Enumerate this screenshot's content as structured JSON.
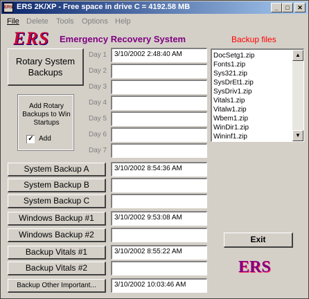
{
  "window": {
    "title": "ERS 2K/XP  -  Free space in drive C = 4192.58 MB"
  },
  "menu": [
    "File",
    "Delete",
    "Tools",
    "Options",
    "Help"
  ],
  "header": {
    "logo": "ERS",
    "subtitle": "Emergency Recovery System",
    "backup_files_title": "Backup files"
  },
  "rotary": {
    "button": "Rotary System Backups",
    "days": [
      {
        "label": "Day 1",
        "value": "3/10/2002 2:48:40 AM"
      },
      {
        "label": "Day 2",
        "value": ""
      },
      {
        "label": "Day 3",
        "value": ""
      },
      {
        "label": "Day 4",
        "value": ""
      },
      {
        "label": "Day 5",
        "value": ""
      },
      {
        "label": "Day 6",
        "value": ""
      },
      {
        "label": "Day 7",
        "value": ""
      }
    ],
    "startup_group": {
      "label": "Add Rotary Backups to Win Startups",
      "checkbox_label": "Add",
      "checked": true
    }
  },
  "backups": [
    {
      "label": "System Backup A",
      "value": "3/10/2002 8:54:36 AM"
    },
    {
      "label": "System Backup B",
      "value": ""
    },
    {
      "label": "System Backup C",
      "value": ""
    },
    {
      "label": "Windows Backup #1",
      "value": "3/10/2002 9:53:08 AM"
    },
    {
      "label": "Windows Backup #2",
      "value": ""
    },
    {
      "label": "Backup Vitals #1",
      "value": "3/10/2002 8:55:22 AM"
    },
    {
      "label": "Backup Vitals #2",
      "value": ""
    },
    {
      "label": "Backup Other Important...",
      "value": "3/10/2002 10:03:46 AM"
    }
  ],
  "backup_files": [
    "DocSetg1.zip",
    "Fonts1.zip",
    "Sys321.zip",
    "SysDrEt1.zip",
    "SysDriv1.zip",
    "Vitals1.zip",
    "Vitalw1.zip",
    "Wbem1.zip",
    "WinDir1.zip",
    "Wininf1.zip"
  ],
  "exit_button": "Exit",
  "footer_logo": "ERS",
  "colors": {
    "accent": "#cc0033",
    "subtitle": "#800080",
    "title_bar": "#0a246a"
  }
}
